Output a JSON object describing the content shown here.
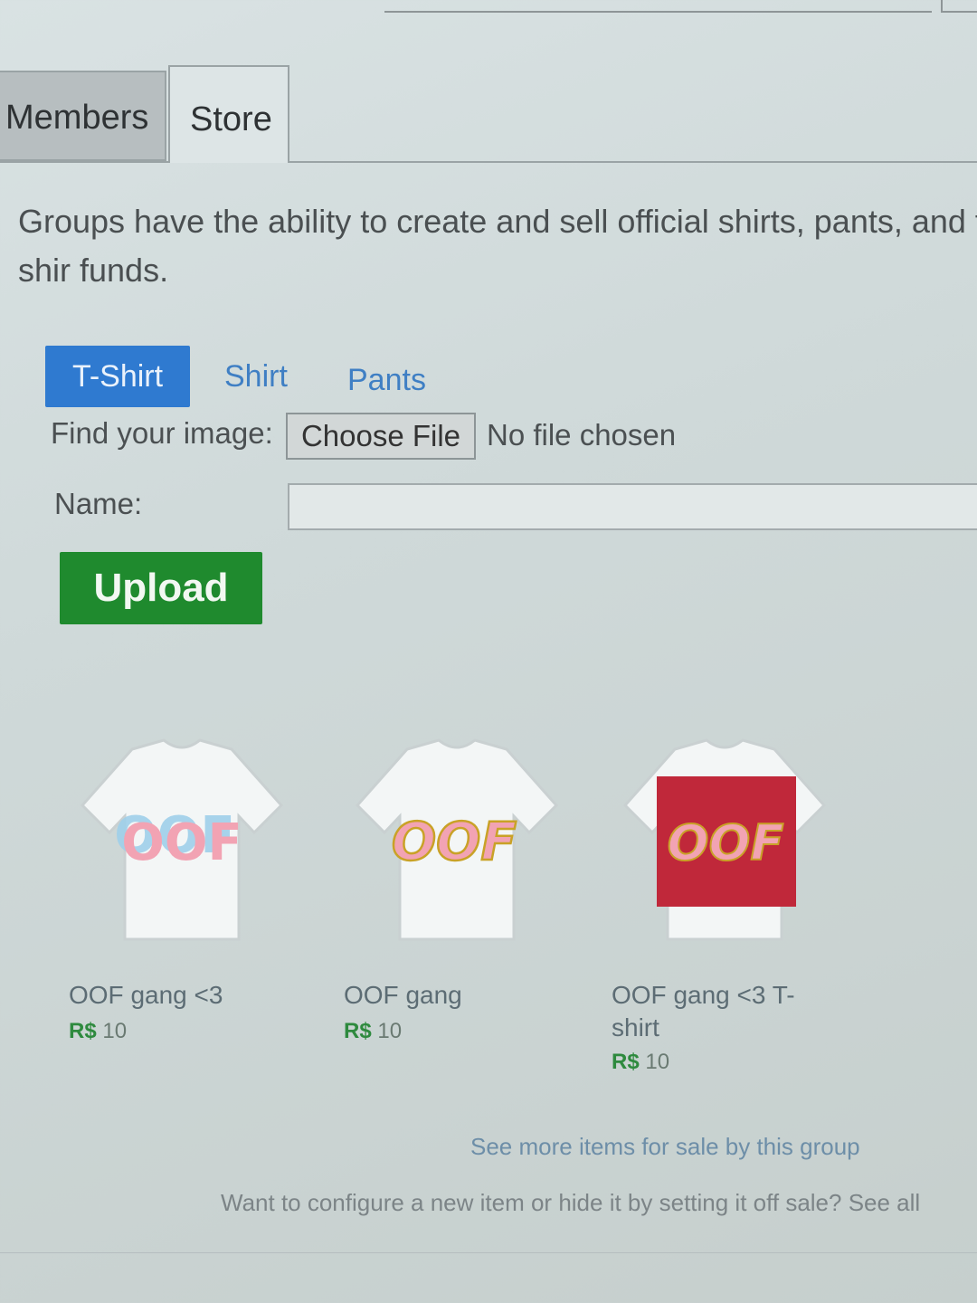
{
  "tabs": {
    "members": "Members",
    "store": "Store"
  },
  "description": "Groups have the ability to create and sell official shirts, pants, and t-shir funds.",
  "upload": {
    "types": [
      "T-Shirt",
      "Shirt",
      "Pants"
    ],
    "active_type": "T-Shirt",
    "find_label": "Find your image:",
    "choose_file": "Choose File",
    "file_status": "No file chosen",
    "name_label": "Name:",
    "name_value": "",
    "upload_button": "Upload"
  },
  "items": [
    {
      "title": "OOF gang <3",
      "currency": "R$",
      "price": "10",
      "image_text": "OOF",
      "image_bg": "#ffffff"
    },
    {
      "title": "OOF gang",
      "currency": "R$",
      "price": "10",
      "image_text": "OOF",
      "image_bg": "#ffffff"
    },
    {
      "title": "OOF gang <3 T-shirt",
      "currency": "R$",
      "price": "10",
      "image_text": "OOF",
      "image_bg": "#c0283a"
    }
  ],
  "see_more": "See more items for sale by this group",
  "configure_note": "Want to configure a new item or hide it by setting it off sale? See all",
  "colors": {
    "tab_active": "#2f7ad0",
    "upload": "#1f8a2e",
    "oof_pink": "#f2a3b3",
    "oof_gold": "#c9a227"
  }
}
